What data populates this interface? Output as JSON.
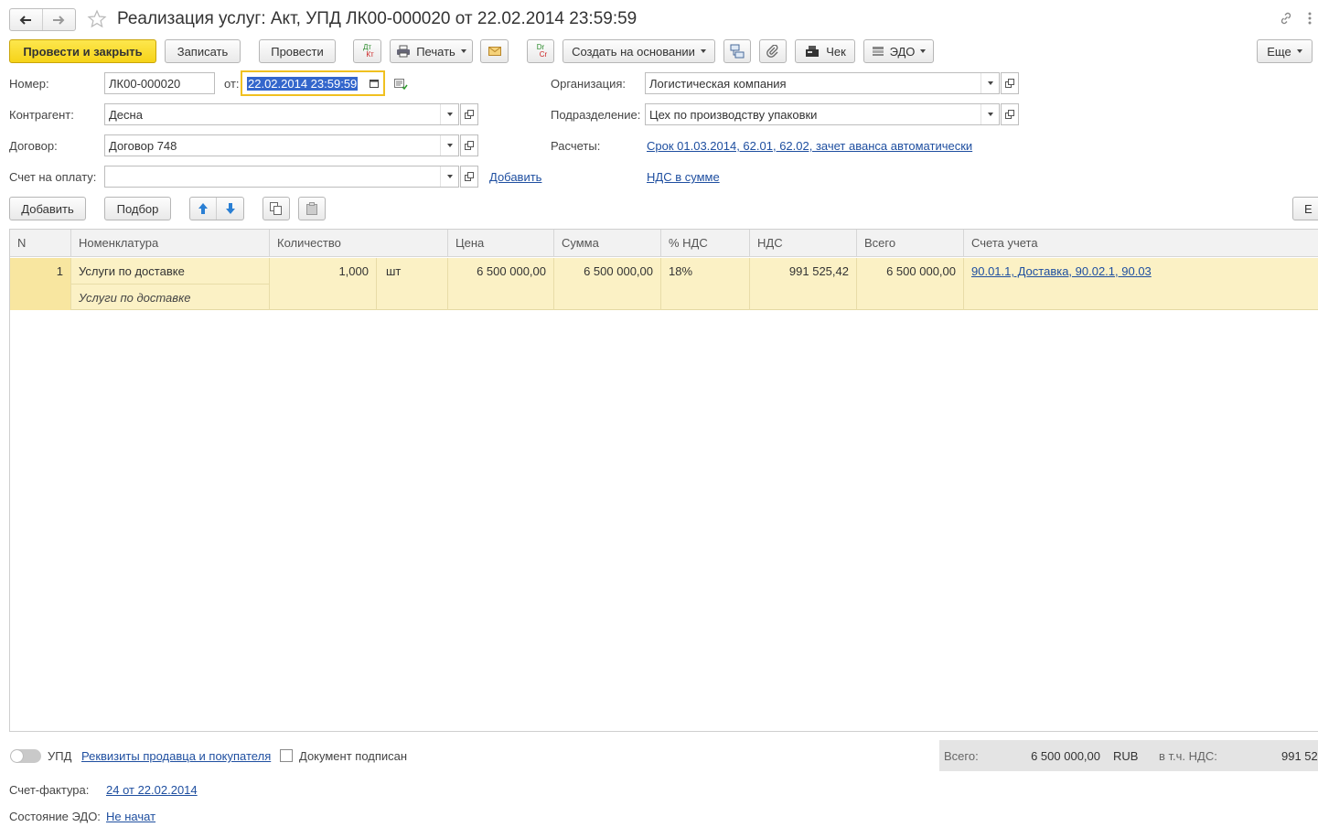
{
  "header": {
    "title": "Реализация услуг: Акт, УПД ЛК00-000020 от 22.02.2014 23:59:59"
  },
  "toolbar": {
    "post_close": "Провести и закрыть",
    "save": "Записать",
    "post": "Провести",
    "dtkt_top": "Дт",
    "dtkt_bottom": "Кт",
    "print": "Печать",
    "drcr_top": "Dr",
    "drcr_bottom": "Cr",
    "create_based": "Создать на основании",
    "receipt": "Чек",
    "edo": "ЭДО",
    "more": "Еще"
  },
  "form": {
    "number_label": "Номер:",
    "number_value": "ЛК00-000020",
    "date_label": "от:",
    "date_value": "22.02.2014 23:59:59",
    "counterparty_label": "Контрагент:",
    "counterparty_value": "Десна",
    "contract_label": "Договор:",
    "contract_value": "Договор 748",
    "invoice_label": "Счет на оплату:",
    "invoice_value": "",
    "invoice_add": "Добавить",
    "org_label": "Организация:",
    "org_value": "Логистическая компания",
    "division_label": "Подразделение:",
    "division_value": "Цех по производству упаковки",
    "settlements_label": "Расчеты:",
    "settlements_link": "Срок 01.03.2014, 62.01, 62.02, зачет аванса автоматически",
    "vat_link": "НДС в сумме"
  },
  "table_toolbar": {
    "add": "Добавить",
    "pick": "Подбор",
    "more_partial": "Е"
  },
  "table": {
    "columns": [
      "N",
      "Номенклатура",
      "Количество",
      "Цена",
      "Сумма",
      "% НДС",
      "НДС",
      "Всего",
      "Счета учета"
    ],
    "rows": [
      {
        "n": "1",
        "item": "Услуги по доставке",
        "item_sub": "Услуги по доставке",
        "qty": "1,000",
        "unit": "шт",
        "price": "6 500 000,00",
        "sum": "6 500 000,00",
        "vat_rate": "18%",
        "vat": "991 525,42",
        "total": "6 500 000,00",
        "accounts": "90.01.1, Доставка, 90.02.1, 90.03"
      }
    ]
  },
  "footer": {
    "upd_label": "УПД",
    "requisites_link": "Реквизиты продавца и покупателя",
    "signed_label": "Документ подписан",
    "total_label": "Всего:",
    "total_value": "6 500 000,00",
    "currency": "RUB",
    "vat_incl_label": "в т.ч. НДС:",
    "vat_incl_value": "991 52",
    "sf_label": "Счет-фактура:",
    "sf_link": "24 от 22.02.2014",
    "edo_label": "Состояние ЭДО:",
    "edo_link": "Не начат"
  },
  "colors": {
    "primary_button": "#f6d319",
    "selected_row": "#fbf1c5",
    "link": "#1f4fa0",
    "date_focus": "#f0c020"
  }
}
